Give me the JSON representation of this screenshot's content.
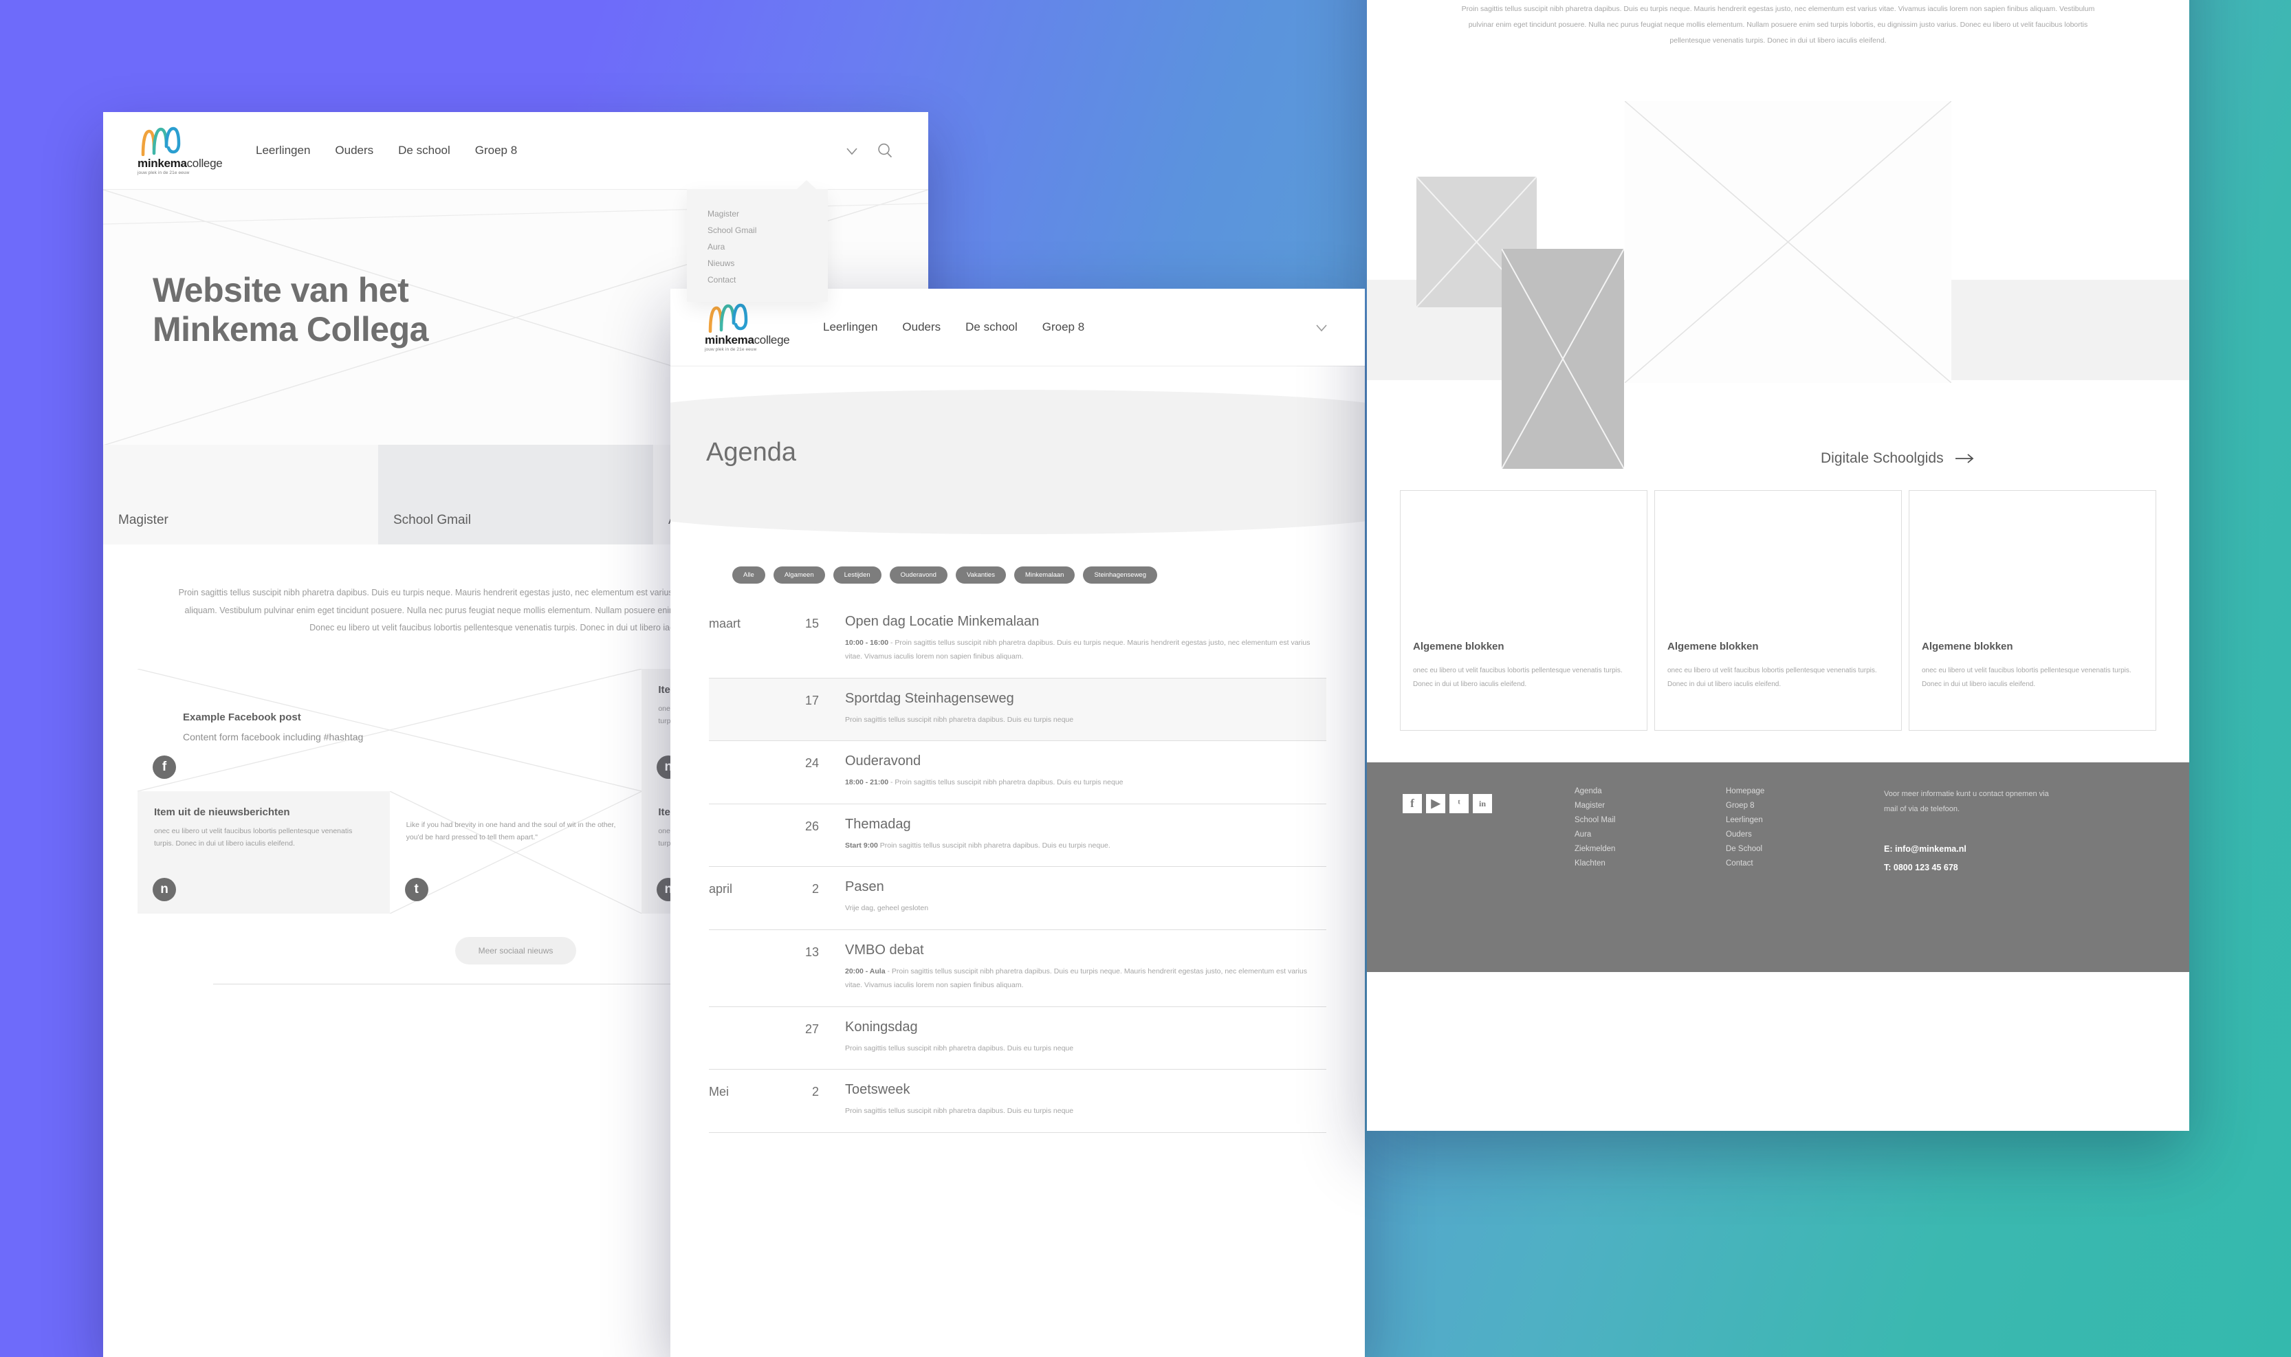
{
  "brand": {
    "name_bold": "minkema",
    "name_light": "college",
    "tagline": "jouw plek in de 21e eeuw"
  },
  "nav": {
    "items": [
      {
        "label": "Leerlingen"
      },
      {
        "label": "Ouders"
      },
      {
        "label": "De school"
      },
      {
        "label": "Groep 8"
      }
    ],
    "chevron_icon": "chevron-down-icon",
    "search_icon": "search-icon"
  },
  "dropdown": {
    "items": [
      {
        "label": "Magister"
      },
      {
        "label": "School Gmail"
      },
      {
        "label": "Aura"
      },
      {
        "label": "Nieuws"
      },
      {
        "label": "Contact"
      }
    ]
  },
  "home": {
    "hero_title_line1": "Website van het",
    "hero_title_line2": "Minkema Collega",
    "tiles": [
      {
        "label": "Magister",
        "active": false
      },
      {
        "label": "School Gmail",
        "active": true
      },
      {
        "label": "Aura",
        "active": false
      }
    ],
    "intro_text": "Proin sagittis tellus suscipit nibh pharetra dapibus. Duis eu turpis neque. Mauris hendrerit egestas justo, nec elementum est varius vitae. Vivamus iaculis lorem non sapien finibus aliquam. Vestibulum pulvinar enim eget tincidunt posuere. Nulla nec purus feugiat neque mollis elementum. Nullam posuere enim sed turpis lobortis, eu dignissim justo varius. Donec eu libero ut velit faucibus lobortis pellentesque venenatis turpis. Donec in dui ut libero iaculis eleifend.",
    "social_cards": [
      {
        "kind": "facebook",
        "title": "Example Facebook post",
        "body": "Content form facebook including #hashtag",
        "badge": "f"
      },
      {
        "kind": "news",
        "title": "Item uit de nieuwsberichten",
        "body": "onec eu libero ut velit faucibus lobortis pellentesque venenatis turpis. Donec in dui ut libero iaculis eleifend.",
        "badge": "n"
      },
      {
        "kind": "news",
        "title": "Item uit de nieuwsberichten",
        "body": "onec eu libero ut velit faucibus lobortis pellentesque venenatis turpis. Donec in dui ut libero iaculis eleifend.",
        "badge": "n"
      },
      {
        "kind": "twitter",
        "title": "",
        "body": "Like if you had brevity in one hand and the soul of wit in the other, you'd be hard pressed to tell them apart.\"",
        "badge": "t"
      },
      {
        "kind": "news",
        "title": "Item uit de nieuwsberichten",
        "body": "onec eu libero ut velit faucibus lobortis pellentesque venenatis turpis. Donec in dui ut libero iaculis eleifend.",
        "badge": "n"
      }
    ],
    "more_button": "Meer sociaal nieuws"
  },
  "agenda": {
    "title": "Agenda",
    "filters": [
      {
        "label": "Alle"
      },
      {
        "label": "Algameen"
      },
      {
        "label": "Lestijden"
      },
      {
        "label": "Ouderavond"
      },
      {
        "label": "Vakanties"
      },
      {
        "label": "Minkemalaan"
      },
      {
        "label": "Steinhagenseweg"
      }
    ],
    "events": [
      {
        "month": "maart",
        "day": "15",
        "title": "Open dag Locatie Minkemalaan",
        "time": "10:00 - 16:00",
        "sep": " - ",
        "desc": "Proin sagittis tellus suscipit nibh pharetra dapibus. Duis eu turpis neque. Mauris hendrerit egestas justo, nec elementum est varius vitae. Vivamus iaculis lorem non sapien finibus aliquam.",
        "highlight": false
      },
      {
        "month": "",
        "day": "17",
        "title": "Sportdag Steinhagenseweg",
        "time": "",
        "sep": "",
        "desc": "Proin sagittis tellus suscipit nibh pharetra dapibus. Duis eu turpis neque",
        "highlight": true
      },
      {
        "month": "",
        "day": "24",
        "title": "Ouderavond",
        "time": "18:00 - 21:00",
        "sep": " - ",
        "desc": "Proin sagittis tellus suscipit nibh pharetra dapibus. Duis eu turpis neque",
        "highlight": false
      },
      {
        "month": "",
        "day": "26",
        "title": "Themadag",
        "time": "Start 9:00",
        "sep": "  ",
        "desc": "Proin sagittis tellus suscipit nibh pharetra dapibus. Duis eu turpis neque.",
        "highlight": false
      },
      {
        "month": "april",
        "day": "2",
        "title": "Pasen",
        "time": "",
        "sep": "",
        "desc": "Vrije dag, geheel gesloten",
        "highlight": false
      },
      {
        "month": "",
        "day": "13",
        "title": "VMBO debat",
        "time": "20:00 - Aula",
        "sep": " - ",
        "desc": "Proin sagittis tellus suscipit nibh pharetra dapibus. Duis eu turpis neque. Mauris hendrerit egestas justo, nec elementum est varius vitae. Vivamus iaculis lorem non sapien finibus aliquam.",
        "highlight": false
      },
      {
        "month": "",
        "day": "27",
        "title": "Koningsdag",
        "time": "",
        "sep": "",
        "desc": "Proin sagittis tellus suscipit nibh pharetra dapibus. Duis eu turpis neque",
        "highlight": false
      },
      {
        "month": "Mei",
        "day": "2",
        "title": "Toetsweek",
        "time": "",
        "sep": "",
        "desc": "Proin sagittis tellus suscipit nibh pharetra dapibus. Duis eu turpis neque",
        "highlight": false
      }
    ]
  },
  "gids": {
    "intro_text": "Proin sagittis tellus suscipit nibh pharetra dapibus. Duis eu turpis neque. Mauris hendrerit egestas justo, nec elementum est varius vitae. Vivamus iaculis lorem non sapien finibus aliquam. Vestibulum pulvinar enim eget tincidunt posuere. Nulla nec purus feugiat neque mollis elementum. Nullam posuere enim sed turpis lobortis, eu dignissim justo varius. Donec eu libero ut velit faucibus lobortis pellentesque venenatis turpis. Donec in dui ut libero iaculis eleifend.",
    "link_label": "Digitale Schoolgids",
    "link_icon": "arrow-right-icon",
    "cards": [
      {
        "title": "Algemene blokken",
        "body": "onec eu libero ut velit faucibus lobortis pellentesque venenatis turpis. Donec in dui ut libero iaculis eleifend."
      },
      {
        "title": "Algemene blokken",
        "body": "onec eu libero ut velit faucibus lobortis pellentesque venenatis turpis. Donec in dui ut libero iaculis eleifend."
      },
      {
        "title": "Algemene blokken",
        "body": "onec eu libero ut velit faucibus lobortis pellentesque venenatis turpis. Donec in dui ut libero iaculis eleifend."
      }
    ]
  },
  "footer": {
    "social": [
      {
        "icon": "facebook-icon",
        "glyph": "f"
      },
      {
        "icon": "youtube-icon",
        "glyph": "▶"
      },
      {
        "icon": "twitter-icon",
        "glyph": "ᵗ"
      },
      {
        "icon": "linkedin-icon",
        "glyph": "in"
      }
    ],
    "col1": [
      {
        "label": "Agenda"
      },
      {
        "label": "Magister"
      },
      {
        "label": "School Mail"
      },
      {
        "label": "Aura"
      },
      {
        "label": "Ziekmelden"
      },
      {
        "label": "Klachten"
      }
    ],
    "col2": [
      {
        "label": "Homepage"
      },
      {
        "label": "Groep 8"
      },
      {
        "label": "Leerlingen"
      },
      {
        "label": "Ouders"
      },
      {
        "label": "De School"
      },
      {
        "label": "Contact"
      }
    ],
    "contact_text": "Voor meer informatie kunt u contact opnemen via mail of via de telefoon.",
    "email": "E: info@minkema.nl",
    "phone": "T: 0800 123 45 678"
  },
  "colors": {
    "bg_purple": "#6e6bfa",
    "bg_blue": "#5096cc",
    "bg_teal": "#3bb8b0",
    "footer_grey": "#7a7a7a",
    "chip_grey": "#7d7d7d"
  }
}
